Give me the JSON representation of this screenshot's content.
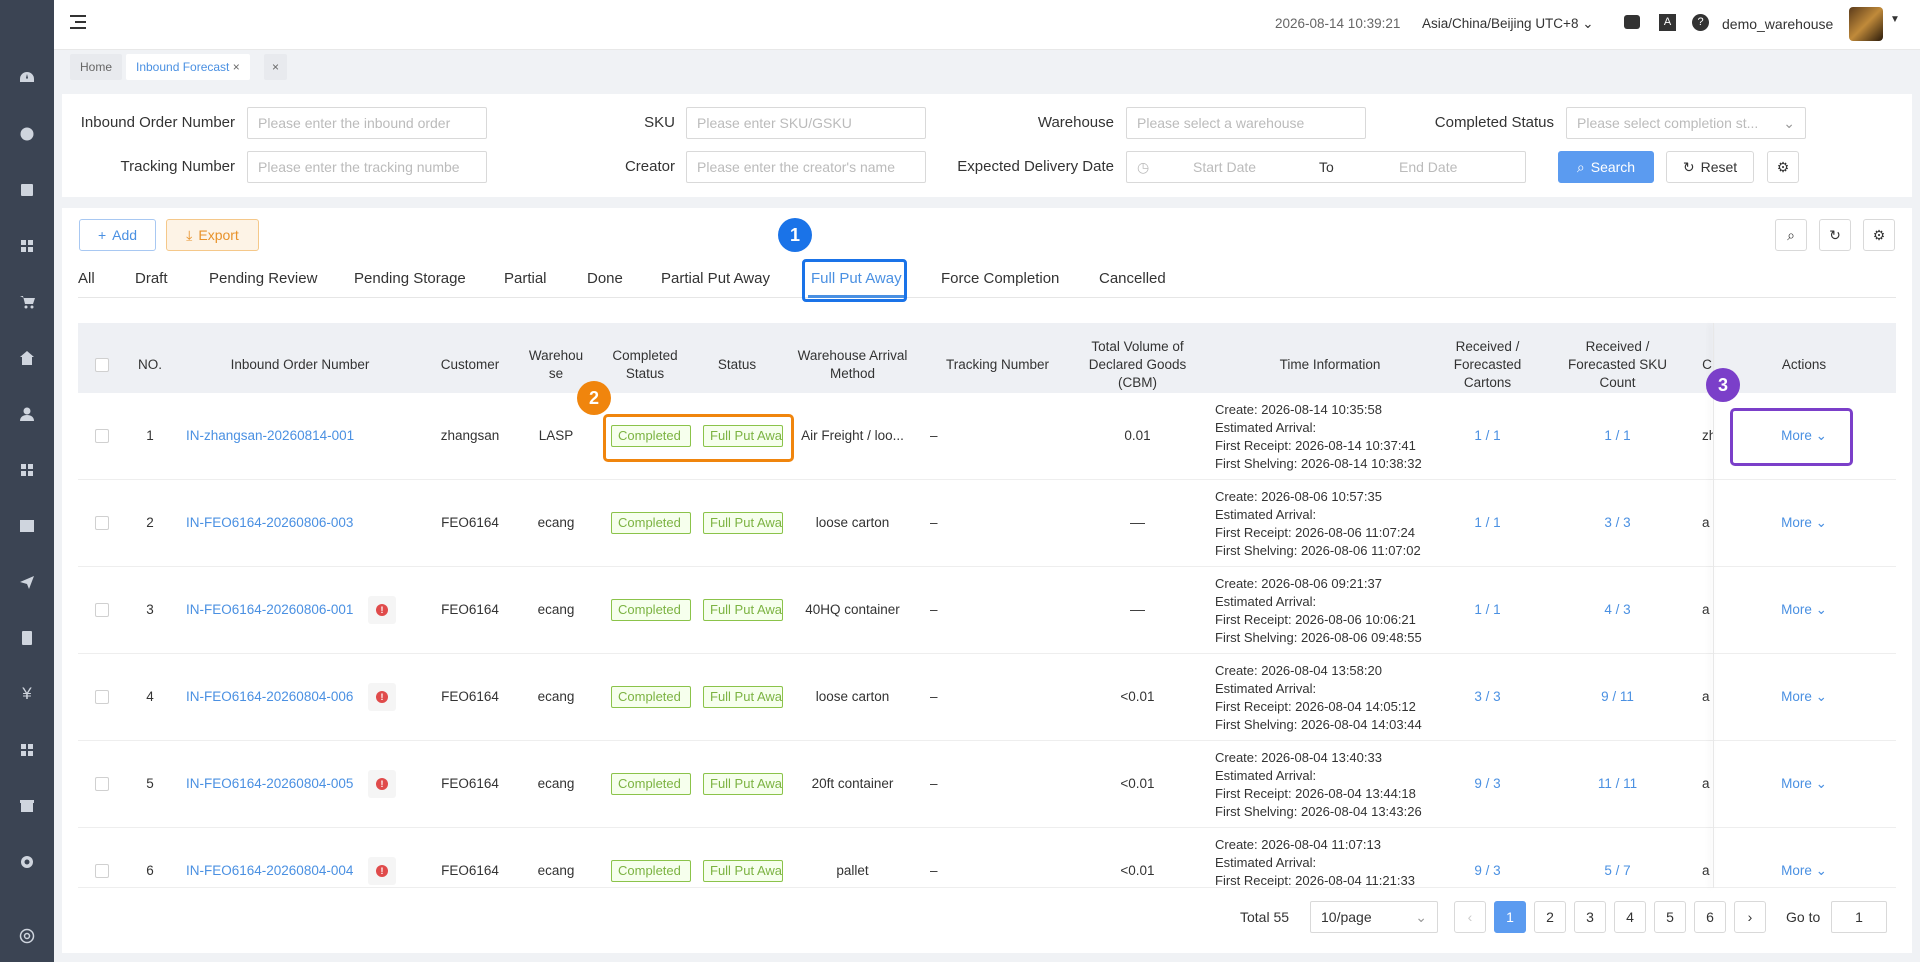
{
  "topbar": {
    "datetime": "2026-08-14 10:39:21",
    "timezone": "Asia/China/Beijing UTC+8",
    "username": "demo_warehouse"
  },
  "tabs": {
    "home": "Home",
    "active": "Inbound Forecast"
  },
  "filters": {
    "inbound_order_label": "Inbound Order Number",
    "inbound_order_placeholder": "Please enter the inbound order",
    "sku_label": "SKU",
    "sku_placeholder": "Please enter SKU/GSKU",
    "warehouse_label": "Warehouse",
    "warehouse_placeholder": "Please select a warehouse",
    "completed_label": "Completed Status",
    "completed_placeholder": "Please select completion st...",
    "tracking_label": "Tracking Number",
    "tracking_placeholder": "Please enter the tracking numbe",
    "creator_label": "Creator",
    "creator_placeholder": "Please enter the creator's name",
    "date_label": "Expected Delivery Date",
    "start_date": "Start Date",
    "to": "To",
    "end_date": "End Date",
    "search": "Search",
    "reset": "Reset"
  },
  "toolbar": {
    "add": "Add",
    "export": "Export"
  },
  "status_tabs": [
    "All",
    "Draft",
    "Pending Review",
    "Pending Storage",
    "Partial",
    "Done",
    "Partial Put Away",
    "Full Put Away",
    "Force Completion",
    "Cancelled"
  ],
  "table": {
    "headers": {
      "no": "NO.",
      "order": "Inbound Order Number",
      "customer": "Customer",
      "warehouse": "Warehou se",
      "completed": "Completed Status",
      "status": "Status",
      "method": "Warehouse Arrival Method",
      "tracking": "Tracking Number",
      "volume": "Total Volume of Declared Goods (CBM)",
      "time": "Time Information",
      "cartons": "Received / Forecasted Cartons",
      "sku": "Received / Forecasted SKU Count",
      "creator": "C",
      "actions": "Actions"
    },
    "rows": [
      {
        "no": "1",
        "order": "IN-zhangsan-20260814-001",
        "warn": false,
        "customer": "zhangsan",
        "warehouse": "LASP",
        "completed": "Completed",
        "status": "Full Put Away",
        "method": "Air Freight / loo...",
        "tracking": "–",
        "volume": "0.01",
        "create": "Create:   2026-08-14 10:35:58",
        "arrival": "Estimated Arrival:",
        "receipt": "First Receipt: 2026-08-14 10:37:41",
        "shelving": "First Shelving: 2026-08-14 10:38:32",
        "cartons": "1 / 1",
        "sku": "1 / 1",
        "creator": "zha",
        "more": "More"
      },
      {
        "no": "2",
        "order": "IN-FEO6164-20260806-003",
        "warn": false,
        "customer": "FEO6164",
        "warehouse": "ecang",
        "completed": "Completed",
        "status": "Full Put Away",
        "method": "loose carton",
        "tracking": "–",
        "volume": "––",
        "create": "Create:   2026-08-06 10:57:35",
        "arrival": "Estimated Arrival:",
        "receipt": "First Receipt: 2026-08-06 11:07:24",
        "shelving": "First Shelving: 2026-08-06 11:07:02",
        "cartons": "1 / 1",
        "sku": "3 / 3",
        "creator": "a",
        "more": "More"
      },
      {
        "no": "3",
        "order": "IN-FEO6164-20260806-001",
        "warn": true,
        "customer": "FEO6164",
        "warehouse": "ecang",
        "completed": "Completed",
        "status": "Full Put Away",
        "method": "40HQ container",
        "tracking": "–",
        "volume": "––",
        "create": "Create:   2026-08-06 09:21:37",
        "arrival": "Estimated Arrival:",
        "receipt": "First Receipt: 2026-08-06 10:06:21",
        "shelving": "First Shelving: 2026-08-06 09:48:55",
        "cartons": "1 / 1",
        "sku": "4 / 3",
        "creator": "a",
        "more": "More"
      },
      {
        "no": "4",
        "order": "IN-FEO6164-20260804-006",
        "warn": true,
        "customer": "FEO6164",
        "warehouse": "ecang",
        "completed": "Completed",
        "status": "Full Put Away",
        "method": "loose carton",
        "tracking": "–",
        "volume": "<0.01",
        "create": "Create:   2026-08-04 13:58:20",
        "arrival": "Estimated Arrival:",
        "receipt": "First Receipt: 2026-08-04 14:05:12",
        "shelving": "First Shelving: 2026-08-04 14:03:44",
        "cartons": "3 / 3",
        "sku": "9 / 11",
        "creator": "a",
        "more": "More"
      },
      {
        "no": "5",
        "order": "IN-FEO6164-20260804-005",
        "warn": true,
        "customer": "FEO6164",
        "warehouse": "ecang",
        "completed": "Completed",
        "status": "Full Put Away",
        "method": "20ft container",
        "tracking": "–",
        "volume": "<0.01",
        "create": "Create:   2026-08-04 13:40:33",
        "arrival": "Estimated Arrival:",
        "receipt": "First Receipt: 2026-08-04 13:44:18",
        "shelving": "First Shelving: 2026-08-04 13:43:26",
        "cartons": "9 / 3",
        "sku": "11 / 11",
        "creator": "a",
        "more": "More"
      },
      {
        "no": "6",
        "order": "IN-FEO6164-20260804-004",
        "warn": true,
        "customer": "FEO6164",
        "warehouse": "ecang",
        "completed": "Completed",
        "status": "Full Put Away",
        "method": "pallet",
        "tracking": "–",
        "volume": "<0.01",
        "create": "Create:   2026-08-04 11:07:13",
        "arrival": "Estimated Arrival:",
        "receipt": "First Receipt: 2026-08-04 11:21:33",
        "shelving": "",
        "cartons": "9 / 3",
        "sku": "5 / 7",
        "creator": "a",
        "more": "More"
      }
    ]
  },
  "pagination": {
    "total": "Total 55",
    "per_page": "10/page",
    "pages": [
      "1",
      "2",
      "3",
      "4",
      "5",
      "6"
    ],
    "goto": "Go to",
    "goto_value": "1"
  },
  "annotations": [
    "1",
    "2",
    "3"
  ],
  "colors": {
    "sidebar": "#3b4453",
    "primary": "#5b9bf0",
    "link": "#4a90e2",
    "badge1": "#1a73e8",
    "badge2": "#f0850d",
    "badge3": "#7b3fc9"
  }
}
